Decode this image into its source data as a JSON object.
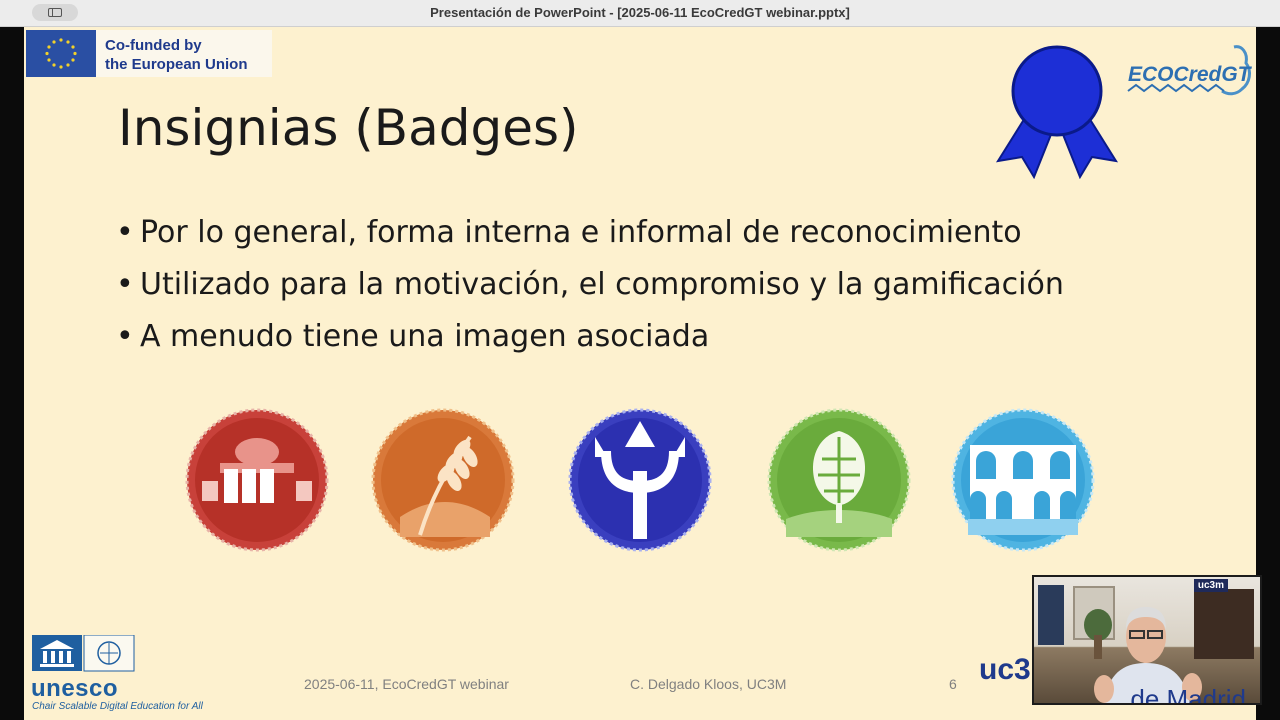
{
  "window": {
    "title": "Presentación de PowerPoint - [2025-06-11 EcoCredGT webinar.pptx]"
  },
  "eu_banner": {
    "line1": "Co-funded by",
    "line2": "the European Union"
  },
  "slide": {
    "title": "Insignias (Badges)",
    "bullets": [
      "Por lo general, forma interna e informal de reconocimiento",
      "Utilizado para la motivación, el compromiso y la gamificación",
      "A menudo tiene una imagen asociada"
    ],
    "badges": [
      {
        "name": "monument-badge",
        "color": "#c8413a"
      },
      {
        "name": "wheat-badge",
        "color": "#d9793a"
      },
      {
        "name": "trident-badge",
        "color": "#3a3fbf"
      },
      {
        "name": "artichoke-badge",
        "color": "#79b94a"
      },
      {
        "name": "aqueduct-badge",
        "color": "#4fb4e2"
      }
    ],
    "eco_logo": "ECOCredGT",
    "footer": {
      "date_event": "2025-06-11, EcoCredGT webinar",
      "author": "C. Delgado Kloos, UC3M",
      "page_number": "6"
    },
    "unesco": {
      "word": "unesco",
      "chair": "Chair Scalable Digital Education for All"
    },
    "uc3_logo": "uc3"
  },
  "video_overlay": {
    "tag": "uc3m",
    "bottom_text": "de Madrid"
  },
  "colors": {
    "slide_bg": "#fdf1cf",
    "ribbon_blue": "#1d2fd6",
    "eu_blue": "#2a4fa3"
  }
}
